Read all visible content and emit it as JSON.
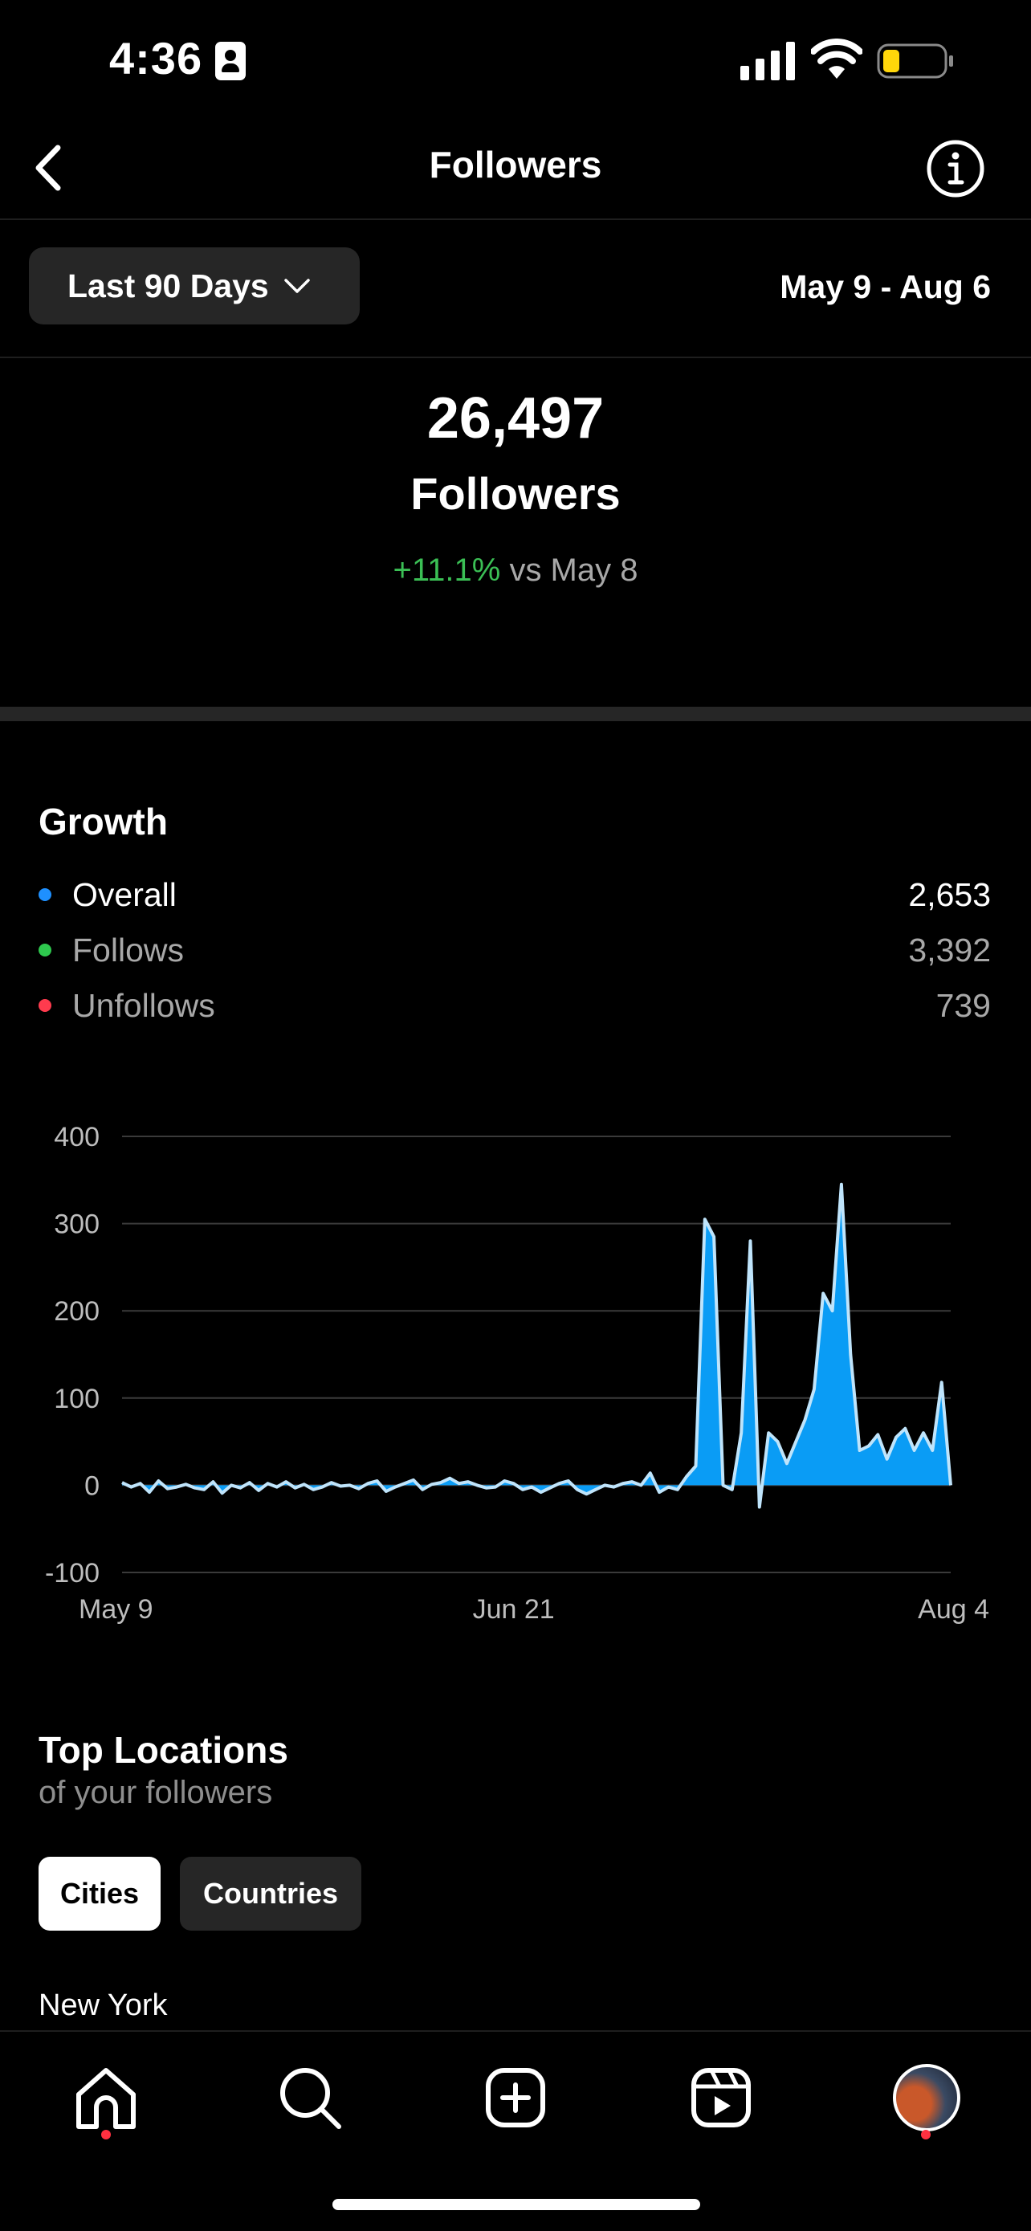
{
  "status_bar": {
    "time": "4:36"
  },
  "header": {
    "title": "Followers"
  },
  "filter": {
    "range_label": "Last 90 Days",
    "date_range": "May 9 - Aug 6"
  },
  "summary": {
    "count": "26,497",
    "label": "Followers",
    "change_pct": "+11.1%",
    "change_ref": " vs May 8"
  },
  "growth": {
    "title": "Growth",
    "legend": [
      {
        "name": "Overall",
        "value": "2,653",
        "color": "#1e90ff"
      },
      {
        "name": "Follows",
        "value": "3,392",
        "color": "#2ec84e"
      },
      {
        "name": "Unfollows",
        "value": "739",
        "color": "#ff3b4e"
      }
    ]
  },
  "chart_data": {
    "type": "area",
    "title": "",
    "xlabel": "",
    "ylabel": "",
    "ylim": [
      -100,
      400
    ],
    "y_ticks": [
      "400",
      "300",
      "200",
      "100",
      "0",
      "-100"
    ],
    "y_tick_values": [
      400,
      300,
      200,
      100,
      0,
      -100
    ],
    "x_tick_labels": [
      "May 9",
      "Jun 21",
      "Aug 4"
    ],
    "x_tick_index": [
      0,
      43,
      87
    ],
    "grid": true,
    "fill_color": "#0a9cf5",
    "line_color": "#bfe4fb",
    "series": [
      {
        "name": "Overall",
        "values": [
          3,
          -2,
          2,
          -8,
          5,
          -4,
          -2,
          1,
          -3,
          -5,
          4,
          -9,
          0,
          -3,
          3,
          -6,
          2,
          -2,
          4,
          -3,
          1,
          -5,
          -2,
          3,
          -1,
          0,
          -4,
          2,
          5,
          -7,
          -2,
          2,
          6,
          -5,
          1,
          3,
          8,
          2,
          4,
          0,
          -3,
          -2,
          5,
          2,
          -5,
          -2,
          -8,
          -3,
          2,
          5,
          -5,
          -10,
          -5,
          0,
          -2,
          2,
          4,
          0,
          14,
          -8,
          -2,
          -5,
          10,
          22,
          305,
          285,
          0,
          -5,
          60,
          280,
          -25,
          60,
          50,
          25,
          50,
          75,
          110,
          220,
          200,
          345,
          150,
          40,
          45,
          58,
          30,
          55,
          65,
          40,
          60,
          40,
          118,
          0
        ]
      }
    ]
  },
  "locations": {
    "title": "Top Locations",
    "subtitle": "of your followers",
    "tabs": [
      "Cities",
      "Countries"
    ],
    "first_item": "New York"
  },
  "icons": {
    "back": "chevron-left-icon",
    "info": "info-icon",
    "nav": [
      "home-icon",
      "search-icon",
      "create-icon",
      "reels-icon",
      "profile-avatar"
    ]
  }
}
